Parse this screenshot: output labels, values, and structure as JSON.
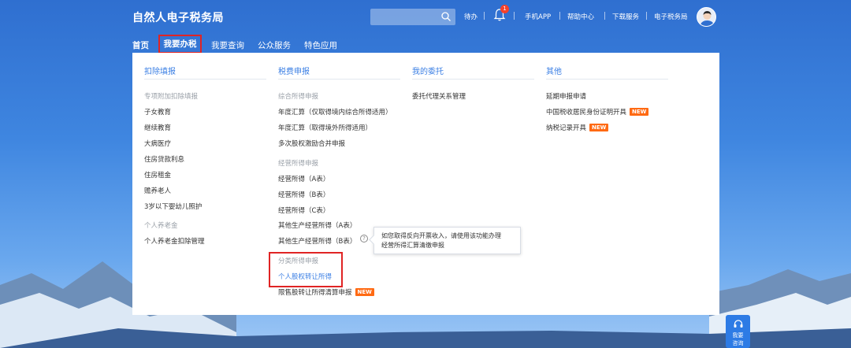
{
  "header": {
    "brand": "自然人电子税务局",
    "todo": "待办",
    "badge_count": "1",
    "links": [
      "手机APP",
      "帮助中心",
      "下载服务",
      "电子税务局"
    ]
  },
  "nav": {
    "items": [
      "首页",
      "我要办税",
      "我要查询",
      "公众服务",
      "特色应用"
    ]
  },
  "menu": {
    "deduction": {
      "title": "扣除填报",
      "group1": "专项附加扣除填报",
      "items1": [
        "子女教育",
        "继续教育",
        "大病医疗",
        "住房贷款利息",
        "住房租金",
        "赡养老人",
        "3岁以下婴幼儿照护"
      ],
      "group2": "个人养老金",
      "items2": [
        "个人养老金扣除管理"
      ]
    },
    "tax_filing": {
      "title": "税费申报",
      "group1": "综合所得申报",
      "items1": [
        "年度汇算（仅取得境内综合所得适用）",
        "年度汇算（取得境外所得适用）",
        "多次股权激励合并申报"
      ],
      "group2": "经营所得申报",
      "items2": [
        "经营所得（A表）",
        "经营所得（B表）",
        "经营所得（C表）",
        "其他生产经营所得（A表）",
        "其他生产经营所得（B表）"
      ],
      "group3": "分类所得申报",
      "items3": [
        "个人股权转让所得",
        "限售股转让所得清算申报"
      ]
    },
    "entrust": {
      "title": "我的委托",
      "items": [
        "委托代理关系管理"
      ]
    },
    "other": {
      "title": "其他",
      "items": [
        "延期申报申请",
        "中国税收居民身份证明开具",
        "纳税记录开具"
      ]
    },
    "new_tag": "NEW",
    "help_mark": "?",
    "tooltip_line1": "如您取得反向开票收入，请使用该功能办理",
    "tooltip_line2": "经营所得汇算清缴申报"
  },
  "service": {
    "line1": "我要",
    "line2": "咨询"
  }
}
